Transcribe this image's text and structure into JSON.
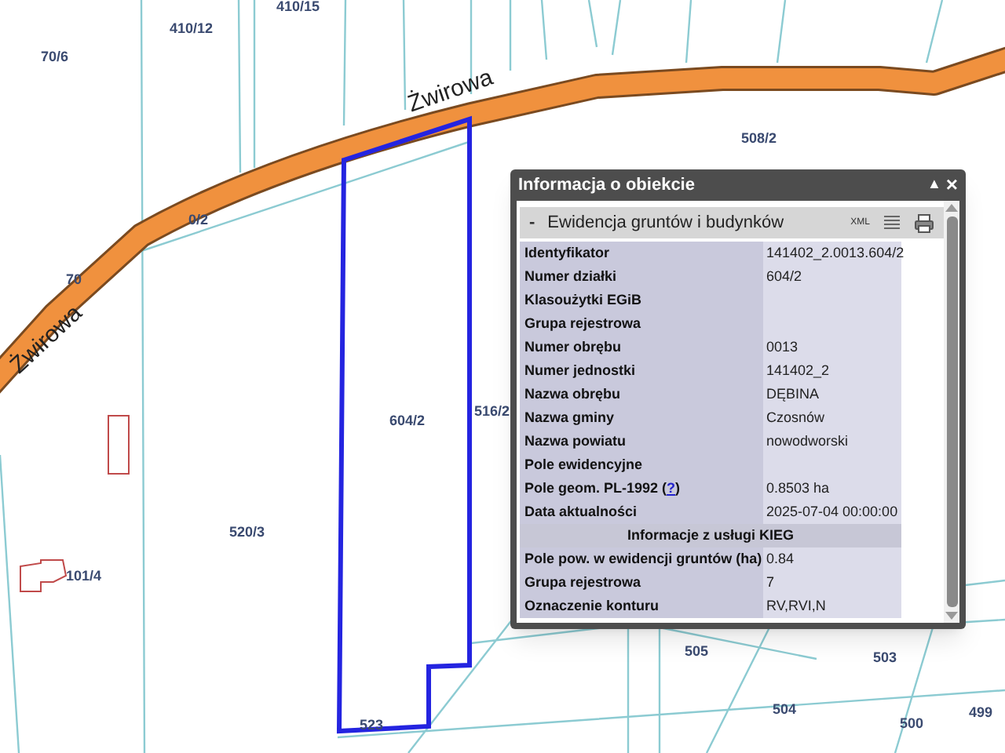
{
  "map": {
    "street_labels": [
      "Żwirowa",
      "Żwirowa"
    ],
    "parcel_labels": [
      "70/6",
      "410/12",
      "410/15",
      "0/2",
      "70",
      "604/2",
      "516/2",
      "520/3",
      "101/4",
      "508/2",
      "505",
      "504",
      "503",
      "500",
      "499",
      "523"
    ]
  },
  "panel": {
    "title": "Informacja o obiekcie",
    "title_buttons": [
      "▲",
      "×"
    ],
    "section": {
      "toggle": "-",
      "title": "Ewidencja gruntów i budynków",
      "xml": "XML"
    },
    "rows": [
      {
        "kind": "field",
        "label": "Identyfikator",
        "value": "141402_2.0013.604/2"
      },
      {
        "kind": "field",
        "label": "Numer działki",
        "value": "604/2"
      },
      {
        "kind": "field",
        "label": "Klasoużytki EGiB"
      },
      {
        "kind": "field",
        "label": "Grupa rejestrowa"
      },
      {
        "kind": "field",
        "label": "Numer obrębu",
        "value": "0013"
      },
      {
        "kind": "field",
        "label": "Numer jednostki",
        "value": "141402_2"
      },
      {
        "kind": "field",
        "label": "Nazwa obrębu",
        "value": "DĘBINA"
      },
      {
        "kind": "field",
        "label": "Nazwa gminy",
        "value": "Czosnów"
      },
      {
        "kind": "field",
        "label": "Nazwa powiatu",
        "value": "nowodworski"
      },
      {
        "kind": "field",
        "label": "Pole ewidencyjne"
      },
      {
        "kind": "field",
        "label": "Pole geom. PL-1992 (",
        "link": "?",
        "label_end": ")",
        "value": "0.8503 ha"
      },
      {
        "kind": "field",
        "label": "Data aktualności",
        "value": "2025-07-04 00:00:00"
      },
      {
        "kind": "section",
        "label": "Informacje z usługi KIEG"
      },
      {
        "kind": "field",
        "label": "Pole pow. w ewidencji gruntów (ha)",
        "value": "0.84"
      },
      {
        "kind": "field",
        "label": "Grupa rejestrowa",
        "value": "7"
      },
      {
        "kind": "field",
        "label": "Oznaczenie konturu",
        "value": "RV,RVI,N"
      }
    ]
  }
}
